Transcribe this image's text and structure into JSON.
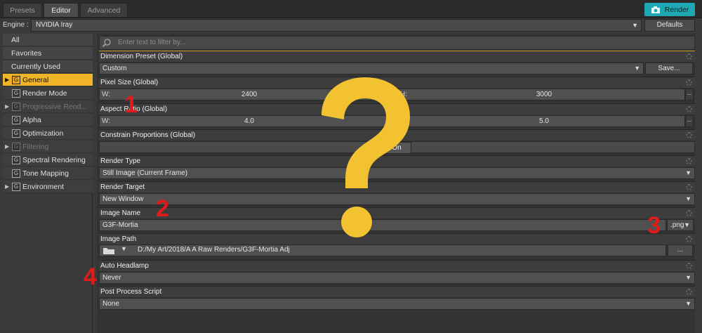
{
  "tabs": [
    {
      "label": "Presets",
      "active": false
    },
    {
      "label": "Editor",
      "active": true
    },
    {
      "label": "Advanced",
      "active": false
    }
  ],
  "render_button": {
    "label": "Render",
    "color": "#1ea8b4"
  },
  "engine": {
    "label": "Engine :",
    "value": "NVIDIA Iray",
    "defaults_label": "Defaults"
  },
  "sidebar": {
    "items": [
      {
        "label": "All"
      },
      {
        "label": "Favorites"
      },
      {
        "label": "Currently Used"
      },
      {
        "label": "General",
        "active": true
      },
      {
        "label": "Render Mode"
      },
      {
        "label": "Progressive Rend...",
        "disabled": true
      },
      {
        "label": "Alpha"
      },
      {
        "label": "Optimization"
      },
      {
        "label": "Filtering",
        "disabled": true
      },
      {
        "label": "Spectral Rendering"
      },
      {
        "label": "Tone Mapping"
      },
      {
        "label": "Environment"
      }
    ],
    "accent": "#f0b428"
  },
  "filter": {
    "placeholder": "Enter text to filter by..."
  },
  "settings": {
    "dimension_preset": {
      "label": "Dimension Preset (Global)",
      "value": "Custom",
      "save_label": "Save..."
    },
    "pixel_size": {
      "label": "Pixel Size (Global)",
      "w_label": "W:",
      "w_value": "2400",
      "h_label": "H:",
      "h_value": "3000"
    },
    "aspect_ratio": {
      "label": "Aspect Ratio (Global)",
      "w_label": "W:",
      "w_value": "4.0",
      "h_label": "H:",
      "h_value": "5.0"
    },
    "constrain": {
      "label": "Constrain Proportions (Global)",
      "value": "On"
    },
    "render_type": {
      "label": "Render Type",
      "value": "Still Image (Current Frame)"
    },
    "render_target": {
      "label": "Render Target",
      "value": "New Window"
    },
    "image_name": {
      "label": "Image Name",
      "value": "G3F-Mortia",
      "ext": ".png"
    },
    "image_path": {
      "label": "Image Path",
      "value": "D:/My Art/2018/A A Raw Renders/G3F-Mortia Adj",
      "browse_label": "..."
    },
    "auto_headlamp": {
      "label": "Auto Headlamp",
      "value": "Never"
    },
    "post_process": {
      "label": "Post Process Script",
      "value": "None"
    }
  },
  "overlay": {
    "markers": [
      "1",
      "2",
      "3",
      "4"
    ],
    "marker_color": "#e01b1b",
    "question_mark_color": "#f2c230"
  }
}
